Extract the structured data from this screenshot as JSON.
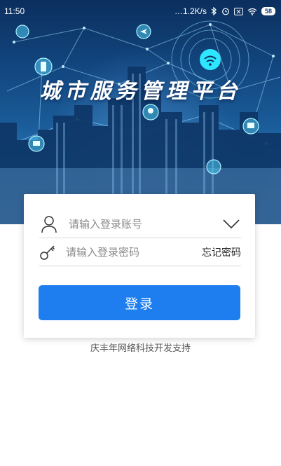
{
  "status_bar": {
    "time": "11:50",
    "net_speed": "…1.2K/s",
    "battery": "58"
  },
  "hero": {
    "title": "城市服务管理平台"
  },
  "login": {
    "account_placeholder": "请输入登录账号",
    "password_placeholder": "请输入登录密码",
    "forgot_password": "忘记密码",
    "submit_label": "登录"
  },
  "footer": {
    "credit": "庆丰年网络科技开发支持"
  },
  "colors": {
    "primary": "#1e7ef0",
    "hero_dark": "#0b2f5e",
    "hero_light": "#5da3db"
  }
}
